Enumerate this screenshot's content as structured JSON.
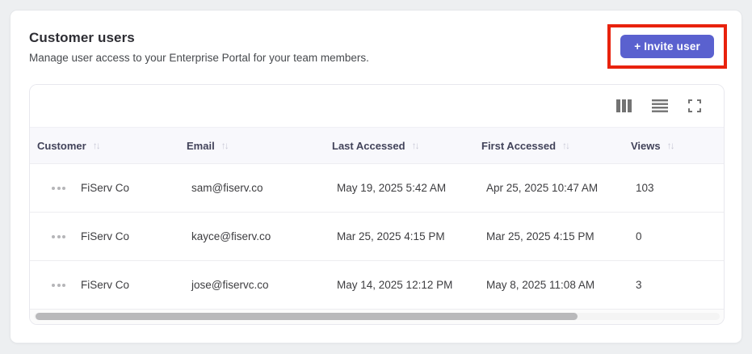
{
  "page": {
    "title": "Customer users",
    "subtitle": "Manage user access to your Enterprise Portal for your team members.",
    "invite_button_label": "+ Invite user"
  },
  "colors": {
    "accent": "#5a61cf",
    "annotation_highlight": "#e8220d",
    "header_row_bg": "#f8f8fc",
    "page_bg": "#edeff1"
  },
  "toolbar": {
    "icons": [
      "columns-icon",
      "row-density-icon",
      "fullscreen-icon"
    ]
  },
  "table": {
    "columns": [
      "Customer",
      "Email",
      "Last Accessed",
      "First Accessed",
      "Views"
    ],
    "sort_glyph_up": "↑",
    "sort_glyph_down": "↓",
    "rows": [
      {
        "customer": "FiServ Co",
        "email": "sam@fiserv.co",
        "last_accessed": "May 19, 2025 5:42 AM",
        "first_accessed": "Apr 25, 2025 10:47 AM",
        "views": "103"
      },
      {
        "customer": "FiServ Co",
        "email": "kayce@fiserv.co",
        "last_accessed": "Mar 25, 2025 4:15 PM",
        "first_accessed": "Mar 25, 2025 4:15 PM",
        "views": "0"
      },
      {
        "customer": "FiServ Co",
        "email": "jose@fiservc.co",
        "last_accessed": "May 14, 2025 12:12 PM",
        "first_accessed": "May 8, 2025 11:08 AM",
        "views": "3"
      }
    ]
  }
}
